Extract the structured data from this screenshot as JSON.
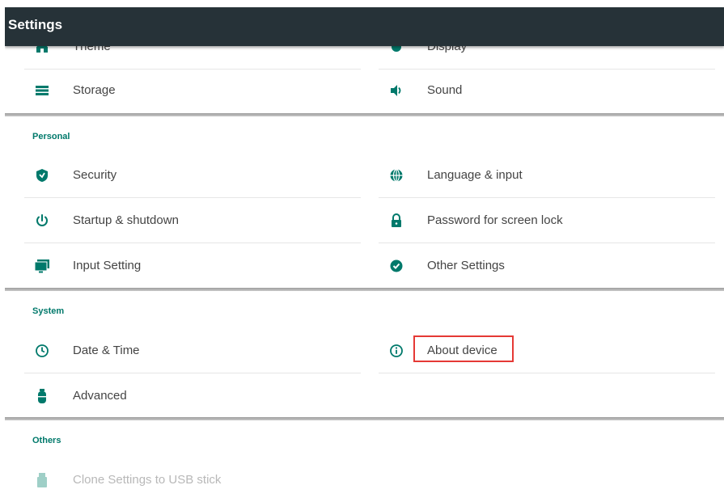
{
  "appbar": {
    "title": "Settings"
  },
  "top": {
    "theme_label": "Theme",
    "display_label": "Display",
    "storage_label": "Storage",
    "sound_label": "Sound"
  },
  "personal": {
    "header": "Personal",
    "security_label": "Security",
    "language_label": "Language & input",
    "startup_label": "Startup & shutdown",
    "password_label": "Password for screen lock",
    "input_label": "Input Setting",
    "other_label": "Other Settings"
  },
  "system": {
    "header": "System",
    "datetime_label": "Date & Time",
    "about_label": "About device",
    "advanced_label": "Advanced"
  },
  "others": {
    "header": "Others",
    "clone_label": "Clone Settings to USB stick"
  },
  "colors": {
    "appbar": "#263238",
    "accent": "#00796b",
    "highlight": "#e53935"
  }
}
